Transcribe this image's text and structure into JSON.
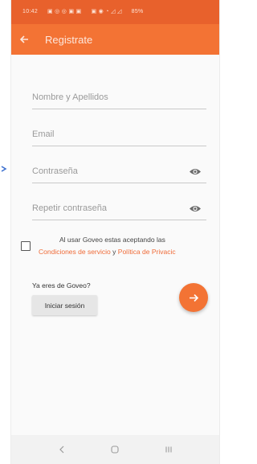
{
  "status_bar": {
    "time": "10:42",
    "battery": "85%"
  },
  "app_bar": {
    "title": "Registrate",
    "back_icon": "arrow-left-icon"
  },
  "form": {
    "name_placeholder": "Nombre y Apellidos",
    "email_placeholder": "Email",
    "password_placeholder": "Contraseña",
    "repeat_password_placeholder": "Repetir contraseña",
    "visibility_icon": "eye-icon"
  },
  "terms": {
    "text_prefix": "Al usar Goveo estas aceptando las",
    "terms_link": "Condiciones de servicio",
    "connector": "y",
    "privacy_link": "Política de Privacic"
  },
  "login": {
    "prompt": "Ya eres de Goveo?",
    "button_label": "Iniciar sesión"
  },
  "fab": {
    "icon": "arrow-right-icon"
  },
  "colors": {
    "status_bar": "#e8612c",
    "accent": "#f37334",
    "link": "#ef6b38"
  }
}
